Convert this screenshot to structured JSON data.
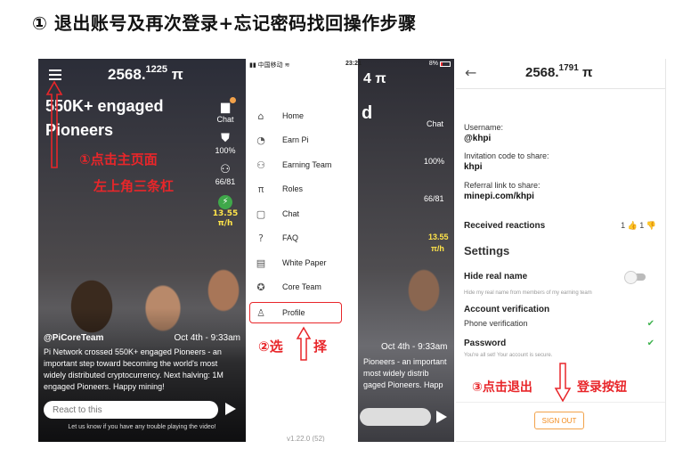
{
  "heading": "① 退出账号及再次登录+忘记密码找回操作步骤",
  "panel1": {
    "balance_main": "2568.",
    "balance_sup": "1225",
    "pi_symbol": "π",
    "headline": "550K+ engaged Pioneers",
    "side": {
      "chat": "Chat",
      "security": "100%",
      "team": "66/81",
      "mining_rate": "13.55",
      "mining_unit": "π/h"
    },
    "annotation1": "①点击主页面",
    "annotation2": "左上角三条杠",
    "post_user": "@PiCoreTeam",
    "post_date": "Oct 4th - 9:33am",
    "post_text": "Pi Network crossed 550K+ engaged Pioneers - an important step toward becoming the world's most widely distributed cryptocurrency. Next halving: 1M engaged Pioneers. Happy mining!",
    "react_placeholder": "React to this",
    "footer_note": "Let us know if you have any trouble playing the video!"
  },
  "panel2": {
    "status_carrier": "中国移动",
    "status_time": "23:21",
    "status_right": "8%",
    "under_balance": "4 π",
    "under_chat": "Chat",
    "under_security": "100%",
    "under_team": "66/81",
    "under_rate": "13.55",
    "under_unit": "π/h",
    "under_date": "Oct 4th - 9:33am",
    "under_text": "Pioneers - an important most widely distrib gaged Pioneers. Happ",
    "menu": [
      {
        "label": "Home",
        "icon": "⌂"
      },
      {
        "label": "Earn Pi",
        "icon": "◔"
      },
      {
        "label": "Earning Team",
        "icon": "⚇"
      },
      {
        "label": "Roles",
        "icon": "π"
      },
      {
        "label": "Chat",
        "icon": "▢"
      },
      {
        "label": "FAQ",
        "icon": "?"
      },
      {
        "label": "White Paper",
        "icon": "▤"
      },
      {
        "label": "Core Team",
        "icon": "✪"
      },
      {
        "label": "Profile",
        "icon": "♙"
      }
    ],
    "annotation": "②选",
    "annotation_b": "择",
    "version": "v1.22.0 (52)"
  },
  "panel3": {
    "back": "←",
    "balance_main": "2568.",
    "balance_sup": "1791",
    "pi_symbol": "π",
    "username_label": "Username:",
    "username_value": "@khpi",
    "invite_label": "Invitation code to share:",
    "invite_value": "khpi",
    "referral_label": "Referral link to share:",
    "referral_value": "minepi.com/khpi",
    "reactions_title": "Received reactions",
    "reactions_value": "1 👍   1 👎",
    "settings_title": "Settings",
    "hide_title": "Hide real name",
    "hide_sub": "Hide my real name from members of my earning team",
    "verification_title": "Account verification",
    "phone_verification": "Phone verification",
    "password_title": "Password",
    "password_sub": "You're all set! Your account is secure.",
    "annotation_a": "③点击退出",
    "annotation_b": "登录按钮",
    "signout": "SIGN OUT"
  },
  "colors": {
    "annotation_red": "#e8262a",
    "signout_orange": "#f28a1a",
    "check_green": "#3fb34f"
  }
}
